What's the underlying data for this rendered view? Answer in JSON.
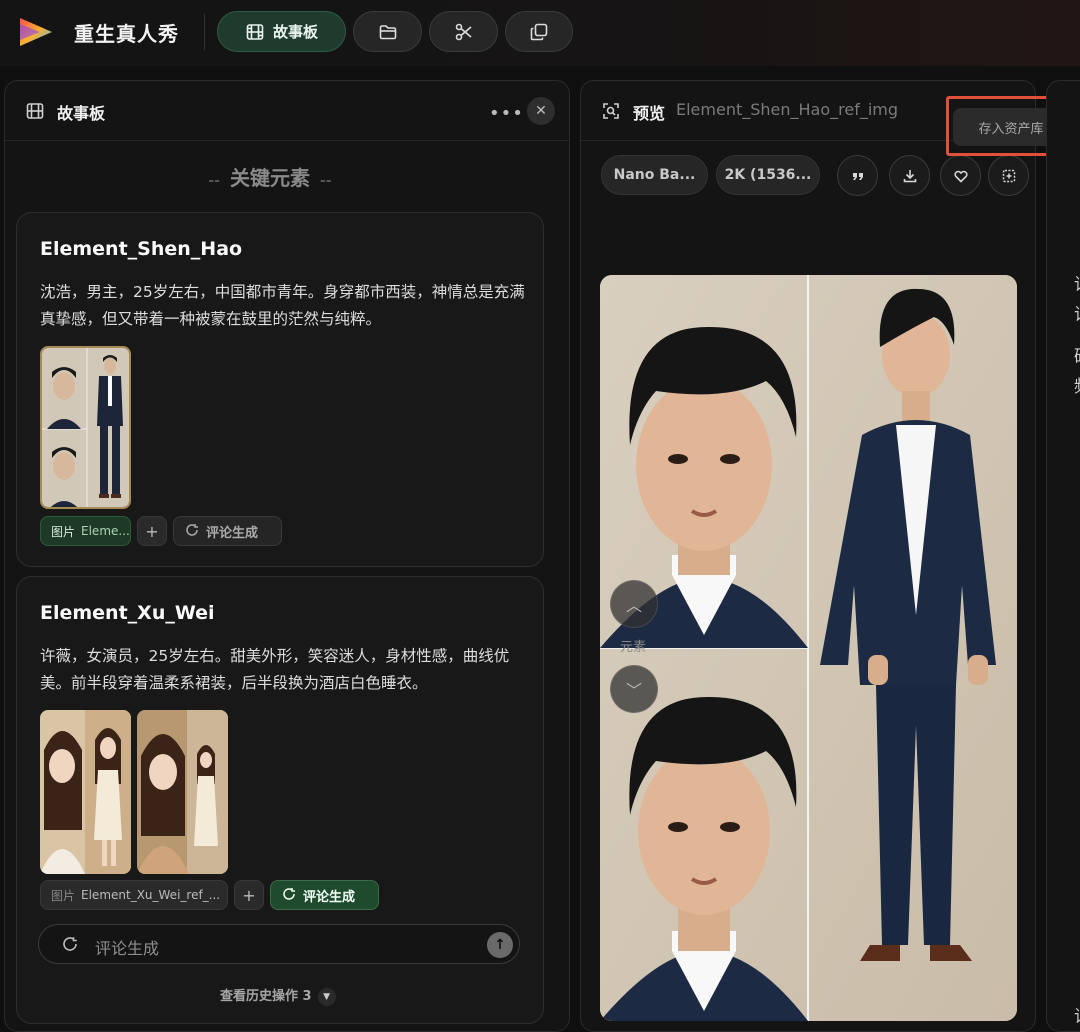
{
  "app": {
    "title": "重生真人秀"
  },
  "toolbar": {
    "storyboard_label": "故事板"
  },
  "storyboard": {
    "title": "故事板",
    "more": "•••",
    "close": "✕",
    "section_title": "关键元素",
    "section_dash": "--",
    "elements": [
      {
        "name": "Element_Shen_Hao",
        "description": "沈浩，男主，25岁左右，中国都市青年。身穿都市西装，神情总是充满真挚感，但又带着一种被蒙在鼓里的茫然与纯粹。",
        "chip_type": "图片",
        "chip_label": "Eleme...",
        "generate_label": "评论生成"
      },
      {
        "name": "Element_Xu_Wei",
        "description": "许薇，女演员，25岁左右。甜美外形，笑容迷人，身材性感，曲线优美。前半段穿着温柔系裙装，后半段换为酒店白色睡衣。",
        "chip_type": "图片",
        "chip_label": "Element_Xu_Wei_ref_...",
        "generate_label": "评论生成"
      }
    ],
    "comment_placeholder": "评论生成",
    "history_label": "查看历史操作 3"
  },
  "preview": {
    "title": "预览",
    "subtitle": "Element_Shen_Hao_ref_img",
    "model": "Nano Ba...",
    "resolution": "2K (1536...",
    "tooltip": "存入资产库",
    "nav_label": "元素"
  },
  "right_panel": {
    "chars": [
      "词",
      "词",
      "硕",
      "频",
      "词"
    ]
  },
  "colors": {
    "accent_green": "#1f3b2d",
    "highlight": "#e0503a",
    "bg": "#0f0f10"
  },
  "icons": [
    "film-icon",
    "folder-icon",
    "scissors-icon",
    "copy-icon",
    "search-zoom-icon",
    "quote-icon",
    "download-icon",
    "heart-icon",
    "crop-add-icon",
    "refresh-icon",
    "send-arrow-icon",
    "chevron-up-icon",
    "chevron-down-icon"
  ]
}
